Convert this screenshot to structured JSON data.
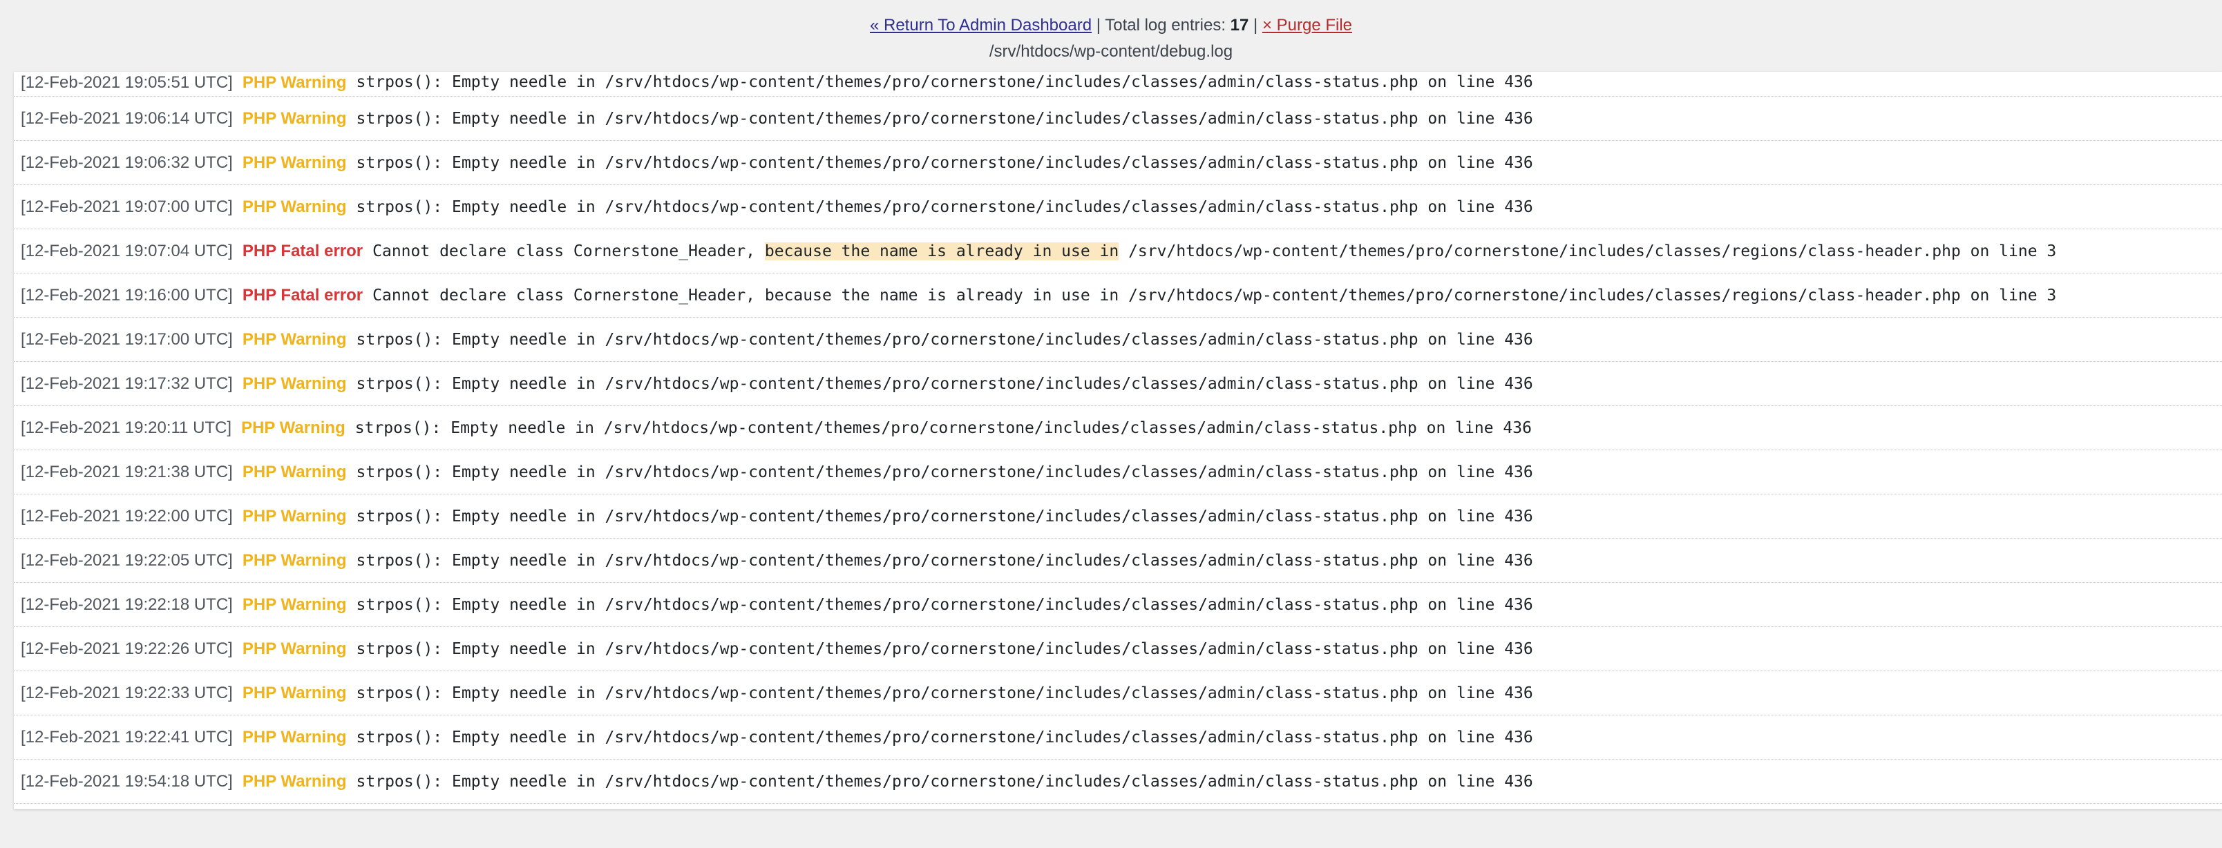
{
  "header": {
    "return_label": "« Return To Admin Dashboard",
    "sep1": " | ",
    "total_label": "Total log entries: ",
    "total_count": "17",
    "sep2": " | ",
    "purge_label": "× Purge File",
    "file_path": "/srv/htdocs/wp-content/debug.log"
  },
  "colors": {
    "warning": "#f0b31e",
    "fatal": "#d63638",
    "link": "#2f2f8f",
    "purge": "#b32d2e",
    "highlight": "#fbe8c0"
  },
  "log": {
    "entries": [
      {
        "timestamp": "[12-Feb-2021 19:05:51 UTC]",
        "level": "PHP Warning",
        "message": "strpos(): Empty needle in /srv/htdocs/wp-content/themes/pro/cornerstone/includes/classes/admin/class-status.php on line 436"
      },
      {
        "timestamp": "[12-Feb-2021 19:06:14 UTC]",
        "level": "PHP Warning",
        "message": "strpos(): Empty needle in /srv/htdocs/wp-content/themes/pro/cornerstone/includes/classes/admin/class-status.php on line 436"
      },
      {
        "timestamp": "[12-Feb-2021 19:06:32 UTC]",
        "level": "PHP Warning",
        "message": "strpos(): Empty needle in /srv/htdocs/wp-content/themes/pro/cornerstone/includes/classes/admin/class-status.php on line 436"
      },
      {
        "timestamp": "[12-Feb-2021 19:07:00 UTC]",
        "level": "PHP Warning",
        "message": "strpos(): Empty needle in /srv/htdocs/wp-content/themes/pro/cornerstone/includes/classes/admin/class-status.php on line 436"
      },
      {
        "timestamp": "[12-Feb-2021 19:07:04 UTC]",
        "level": "PHP Fatal error",
        "message_pre": "Cannot declare class Cornerstone_Header, ",
        "message_hl": "because the name is already in use in",
        "message_post": " /srv/htdocs/wp-content/themes/pro/cornerstone/includes/classes/regions/class-header.php on line 3"
      },
      {
        "timestamp": "[12-Feb-2021 19:16:00 UTC]",
        "level": "PHP Fatal error",
        "message": "Cannot declare class Cornerstone_Header, because the name is already in use in /srv/htdocs/wp-content/themes/pro/cornerstone/includes/classes/regions/class-header.php on line 3"
      },
      {
        "timestamp": "[12-Feb-2021 19:17:00 UTC]",
        "level": "PHP Warning",
        "message": "strpos(): Empty needle in /srv/htdocs/wp-content/themes/pro/cornerstone/includes/classes/admin/class-status.php on line 436"
      },
      {
        "timestamp": "[12-Feb-2021 19:17:32 UTC]",
        "level": "PHP Warning",
        "message": "strpos(): Empty needle in /srv/htdocs/wp-content/themes/pro/cornerstone/includes/classes/admin/class-status.php on line 436"
      },
      {
        "timestamp": "[12-Feb-2021 19:20:11 UTC]",
        "level": "PHP Warning",
        "message": "strpos(): Empty needle in /srv/htdocs/wp-content/themes/pro/cornerstone/includes/classes/admin/class-status.php on line 436"
      },
      {
        "timestamp": "[12-Feb-2021 19:21:38 UTC]",
        "level": "PHP Warning",
        "message": "strpos(): Empty needle in /srv/htdocs/wp-content/themes/pro/cornerstone/includes/classes/admin/class-status.php on line 436"
      },
      {
        "timestamp": "[12-Feb-2021 19:22:00 UTC]",
        "level": "PHP Warning",
        "message": "strpos(): Empty needle in /srv/htdocs/wp-content/themes/pro/cornerstone/includes/classes/admin/class-status.php on line 436"
      },
      {
        "timestamp": "[12-Feb-2021 19:22:05 UTC]",
        "level": "PHP Warning",
        "message": "strpos(): Empty needle in /srv/htdocs/wp-content/themes/pro/cornerstone/includes/classes/admin/class-status.php on line 436"
      },
      {
        "timestamp": "[12-Feb-2021 19:22:18 UTC]",
        "level": "PHP Warning",
        "message": "strpos(): Empty needle in /srv/htdocs/wp-content/themes/pro/cornerstone/includes/classes/admin/class-status.php on line 436"
      },
      {
        "timestamp": "[12-Feb-2021 19:22:26 UTC]",
        "level": "PHP Warning",
        "message": "strpos(): Empty needle in /srv/htdocs/wp-content/themes/pro/cornerstone/includes/classes/admin/class-status.php on line 436"
      },
      {
        "timestamp": "[12-Feb-2021 19:22:33 UTC]",
        "level": "PHP Warning",
        "message": "strpos(): Empty needle in /srv/htdocs/wp-content/themes/pro/cornerstone/includes/classes/admin/class-status.php on line 436"
      },
      {
        "timestamp": "[12-Feb-2021 19:22:41 UTC]",
        "level": "PHP Warning",
        "message": "strpos(): Empty needle in /srv/htdocs/wp-content/themes/pro/cornerstone/includes/classes/admin/class-status.php on line 436"
      },
      {
        "timestamp": "[12-Feb-2021 19:54:18 UTC]",
        "level": "PHP Warning",
        "message": "strpos(): Empty needle in /srv/htdocs/wp-content/themes/pro/cornerstone/includes/classes/admin/class-status.php on line 436"
      }
    ]
  }
}
